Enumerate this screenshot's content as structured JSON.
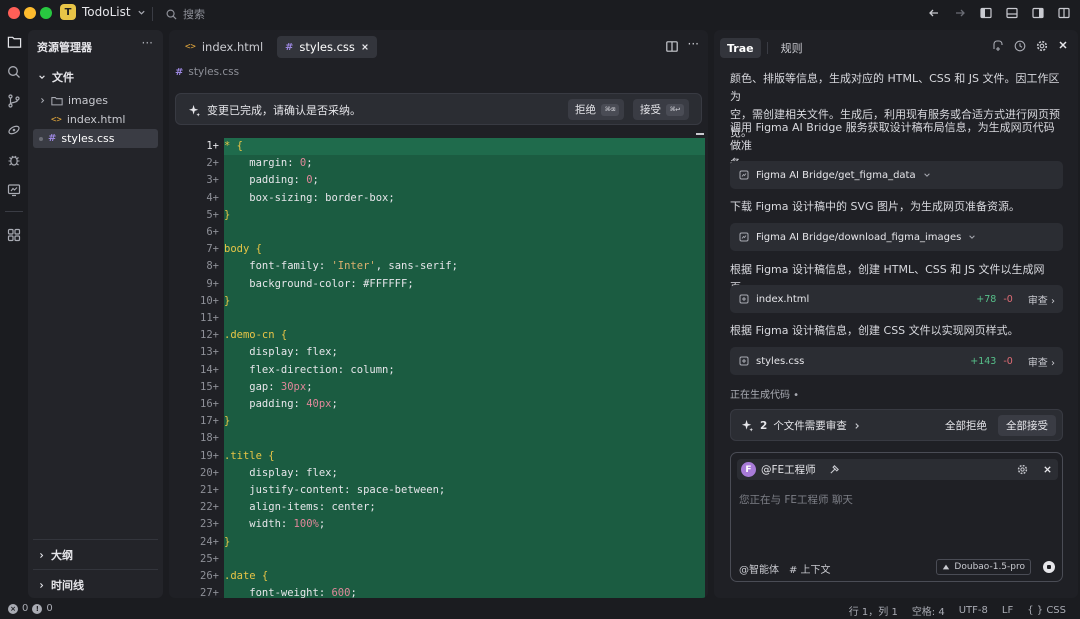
{
  "titlebar": {
    "project_initial": "T",
    "project_name": "TodoList",
    "search_label": "搜索",
    "window_colors": {
      "close": "#ff5f57",
      "minimize": "#febc2e",
      "maximize": "#28c840"
    }
  },
  "explorer": {
    "title": "资源管理器",
    "more": "···",
    "files_section": "文件",
    "items": [
      {
        "name": "images",
        "type": "folder"
      },
      {
        "name": "index.html",
        "type": "html"
      },
      {
        "name": "styles.css",
        "type": "css",
        "active": true
      }
    ],
    "outline_section": "大纲",
    "timeline_section": "时间线"
  },
  "editor": {
    "tabs": [
      {
        "label": "index.html",
        "icon": "html-icon"
      },
      {
        "label": "styles.css",
        "icon": "css-icon",
        "active": true
      }
    ],
    "breadcrumb": "styles.css",
    "diff_message": "变更已完成，请确认是否采纳。",
    "reject_label": "拒绝",
    "reject_kbd": "⌘⌫",
    "accept_label": "接受",
    "accept_kbd": "⌘↩",
    "lines": [
      {
        "n": "1",
        "parts": [
          [
            "sel",
            "* {"
          ]
        ]
      },
      {
        "n": "2",
        "parts": [
          [
            "prop",
            "    margin: "
          ],
          [
            "num",
            "0"
          ],
          [
            "prop",
            ";"
          ]
        ]
      },
      {
        "n": "3",
        "parts": [
          [
            "prop",
            "    padding: "
          ],
          [
            "num",
            "0"
          ],
          [
            "prop",
            ";"
          ]
        ]
      },
      {
        "n": "4",
        "parts": [
          [
            "prop",
            "    box-sizing: border-box;"
          ]
        ]
      },
      {
        "n": "5",
        "parts": [
          [
            "sel",
            "}"
          ]
        ]
      },
      {
        "n": "6",
        "parts": []
      },
      {
        "n": "7",
        "parts": [
          [
            "sel",
            "body {"
          ]
        ]
      },
      {
        "n": "8",
        "parts": [
          [
            "prop",
            "    font-family: "
          ],
          [
            "str",
            "'Inter'"
          ],
          [
            "prop",
            ", sans-serif;"
          ]
        ]
      },
      {
        "n": "9",
        "parts": [
          [
            "prop",
            "    background-color: #FFFFFF;"
          ]
        ]
      },
      {
        "n": "10",
        "parts": [
          [
            "sel",
            "}"
          ]
        ]
      },
      {
        "n": "11",
        "parts": []
      },
      {
        "n": "12",
        "parts": [
          [
            "sel",
            ".demo-cn {"
          ]
        ]
      },
      {
        "n": "13",
        "parts": [
          [
            "prop",
            "    display: flex;"
          ]
        ]
      },
      {
        "n": "14",
        "parts": [
          [
            "prop",
            "    flex-direction: column;"
          ]
        ]
      },
      {
        "n": "15",
        "parts": [
          [
            "prop",
            "    gap: "
          ],
          [
            "num",
            "30px"
          ],
          [
            "prop",
            ";"
          ]
        ]
      },
      {
        "n": "16",
        "parts": [
          [
            "prop",
            "    padding: "
          ],
          [
            "num",
            "40px"
          ],
          [
            "prop",
            ";"
          ]
        ]
      },
      {
        "n": "17",
        "parts": [
          [
            "sel",
            "}"
          ]
        ]
      },
      {
        "n": "18",
        "parts": []
      },
      {
        "n": "19",
        "parts": [
          [
            "sel",
            ".title {"
          ]
        ]
      },
      {
        "n": "20",
        "parts": [
          [
            "prop",
            "    display: flex;"
          ]
        ]
      },
      {
        "n": "21",
        "parts": [
          [
            "prop",
            "    justify-content: space-between;"
          ]
        ]
      },
      {
        "n": "22",
        "parts": [
          [
            "prop",
            "    align-items: center;"
          ]
        ]
      },
      {
        "n": "23",
        "parts": [
          [
            "prop",
            "    width: "
          ],
          [
            "num",
            "100%"
          ],
          [
            "prop",
            ";"
          ]
        ]
      },
      {
        "n": "24",
        "parts": [
          [
            "sel",
            "}"
          ]
        ]
      },
      {
        "n": "25",
        "parts": []
      },
      {
        "n": "26",
        "parts": [
          [
            "sel",
            ".date {"
          ]
        ]
      },
      {
        "n": "27",
        "parts": [
          [
            "prop",
            "    font-weight: "
          ],
          [
            "num",
            "600"
          ],
          [
            "prop",
            ";"
          ]
        ]
      }
    ]
  },
  "chat": {
    "tabs": [
      {
        "label": "Trae",
        "active": true
      },
      {
        "label": "规则"
      }
    ],
    "intro_line1": "颜色、排版等信息，生成对应的 HTML、CSS 和 JS 文件。因工作区为",
    "intro_line2": "空，需创建相关文件。生成后，利用现有服务或合适方式进行网页预览。",
    "step1_text_line1": "调用 Figma AI Bridge 服务获取设计稿布局信息，为生成网页代码做准",
    "step1_text_line2": "备。",
    "tool1": "Figma AI Bridge/get_figma_data",
    "step2_text": "下载 Figma 设计稿中的 SVG 图片，为生成网页准备资源。",
    "tool2": "Figma AI Bridge/download_figma_images",
    "step3_text": "根据 Figma 设计稿信息，创建 HTML、CSS 和 JS 文件以生成网页。",
    "file1": {
      "name": "index.html",
      "add": "+78",
      "del": "-0",
      "review": "审查"
    },
    "step4_text": "根据 Figma 设计稿信息，创建 CSS 文件以实现网页样式。",
    "file2": {
      "name": "styles.css",
      "add": "+143",
      "del": "-0",
      "review": "审查"
    },
    "generating": "正在生成代码 •",
    "review_count": "2",
    "review_text": "个文件需要审查",
    "reject_all": "全部拒绝",
    "accept_all": "全部接受",
    "agent_initial": "F",
    "agent_name": "@FE工程师",
    "input_placeholder": "您正在与 FE工程师 聊天",
    "agent_link": "@智能体",
    "context_link": "# 上下文",
    "model": "Doubao-1.5-pro"
  },
  "status": {
    "errors": "0",
    "warnings": "0",
    "position": "行 1，列 1",
    "spaces": "空格: 4",
    "encoding": "UTF-8",
    "eol": "LF",
    "language": "CSS"
  }
}
